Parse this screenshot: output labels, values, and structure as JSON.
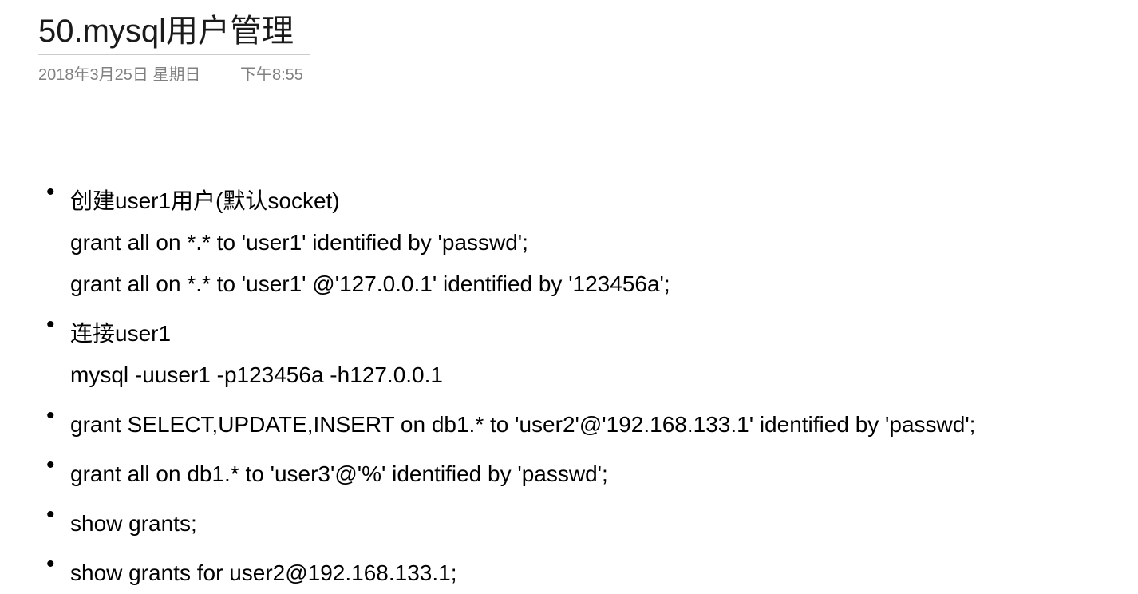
{
  "header": {
    "title": "50.mysql用户管理",
    "date": "2018年3月25日 星期日",
    "time": "下午8:55"
  },
  "items": [
    {
      "lines": [
        "创建user1用户(默认socket)",
        "grant all on *.* to 'user1' identified by 'passwd';",
        "grant all on *.* to 'user1'  @'127.0.0.1' identified by '123456a';"
      ]
    },
    {
      "lines": [
        "连接user1",
        "mysql  -uuser1  -p123456a -h127.0.0.1"
      ]
    },
    {
      "lines": [
        "grant SELECT,UPDATE,INSERT on db1.* to 'user2'@'192.168.133.1' identified by 'passwd';"
      ]
    },
    {
      "lines": [
        "grant all on db1.* to 'user3'@'%' identified by 'passwd';"
      ]
    },
    {
      "lines": [
        "show grants;"
      ]
    },
    {
      "lines": [
        "show grants for user2@192.168.133.1;"
      ]
    }
  ]
}
